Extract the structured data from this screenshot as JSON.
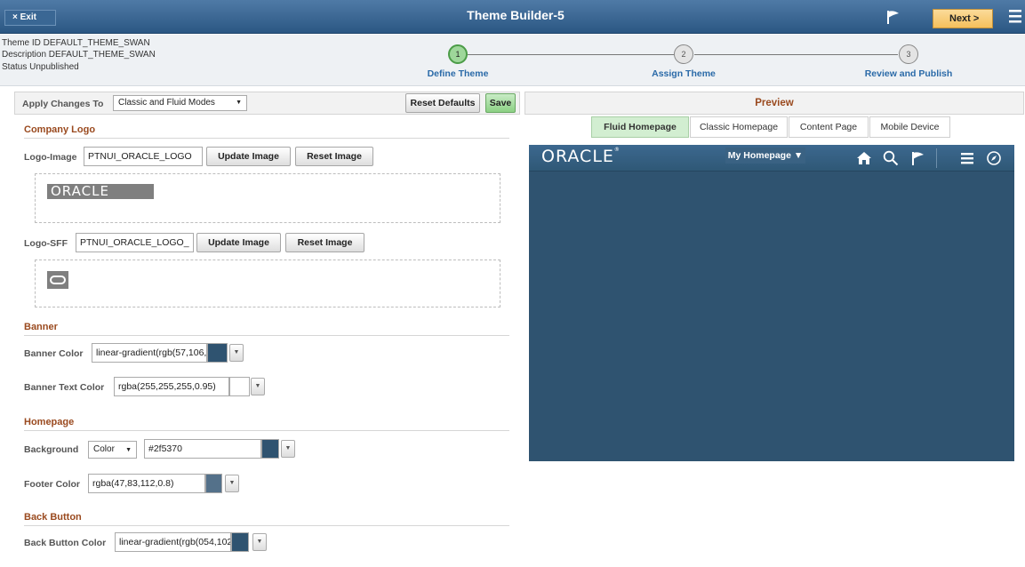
{
  "topbar": {
    "exit_label": "× Exit",
    "title": "Theme Builder-5",
    "next_label": "Next >",
    "icons": [
      "flag-icon",
      "hamburger-menu-icon"
    ]
  },
  "info": {
    "theme_id": "Theme ID  DEFAULT_THEME_SWAN",
    "description": "Description  DEFAULT_THEME_SWAN",
    "status": "Status  Unpublished"
  },
  "steps": [
    {
      "number": "1",
      "label": "Define Theme",
      "active": true
    },
    {
      "number": "2",
      "label": "Assign Theme",
      "active": false
    },
    {
      "number": "3",
      "label": "Review and Publish",
      "active": false
    }
  ],
  "apply": {
    "label": "Apply Changes To",
    "mode_value": "Classic and Fluid Modes",
    "reset_label": "Reset Defaults",
    "save_label": "Save"
  },
  "company_logo": {
    "title": "Company Logo",
    "logo_image_label": "Logo-Image",
    "logo_image_value": "PTNUI_ORACLE_LOGO",
    "logo_sff_label": "Logo-SFF",
    "logo_sff_value": "PTNUI_ORACLE_LOGO_",
    "update_label": "Update Image",
    "reset_label": "Reset Image",
    "logo_text": "ORACLE"
  },
  "banner": {
    "title": "Banner",
    "color_label": "Banner Color",
    "color_value": "linear-gradient(rgb(57,106,",
    "color_swatch": "#2f5370",
    "text_color_label": "Banner Text Color",
    "text_color_value": "rgba(255,255,255,0.95)",
    "text_color_swatch": "#ffffff"
  },
  "homepage": {
    "title": "Homepage",
    "background_label": "Background",
    "background_type": "Color",
    "background_value": "#2f5370",
    "background_swatch": "#2f5370",
    "footer_label": "Footer Color",
    "footer_value": "rgba(47,83,112,0.8)",
    "footer_swatch": "#54718a"
  },
  "back_button": {
    "title": "Back Button",
    "color_label": "Back Button Color",
    "color_value": "linear-gradient(rgb(054,102",
    "color_swatch": "#2f5370"
  },
  "preview": {
    "title": "Preview",
    "tabs": [
      "Fluid Homepage",
      "Classic Homepage",
      "Content Page",
      "Mobile Device"
    ],
    "active_tab": "Fluid Homepage",
    "brand": "ORACLE",
    "homepage_selector": "My Homepage ▼",
    "background": "#2f5370",
    "icons": [
      "home-icon",
      "search-icon",
      "flag-icon",
      "hamburger-menu-icon",
      "navbar-compass-icon"
    ]
  }
}
